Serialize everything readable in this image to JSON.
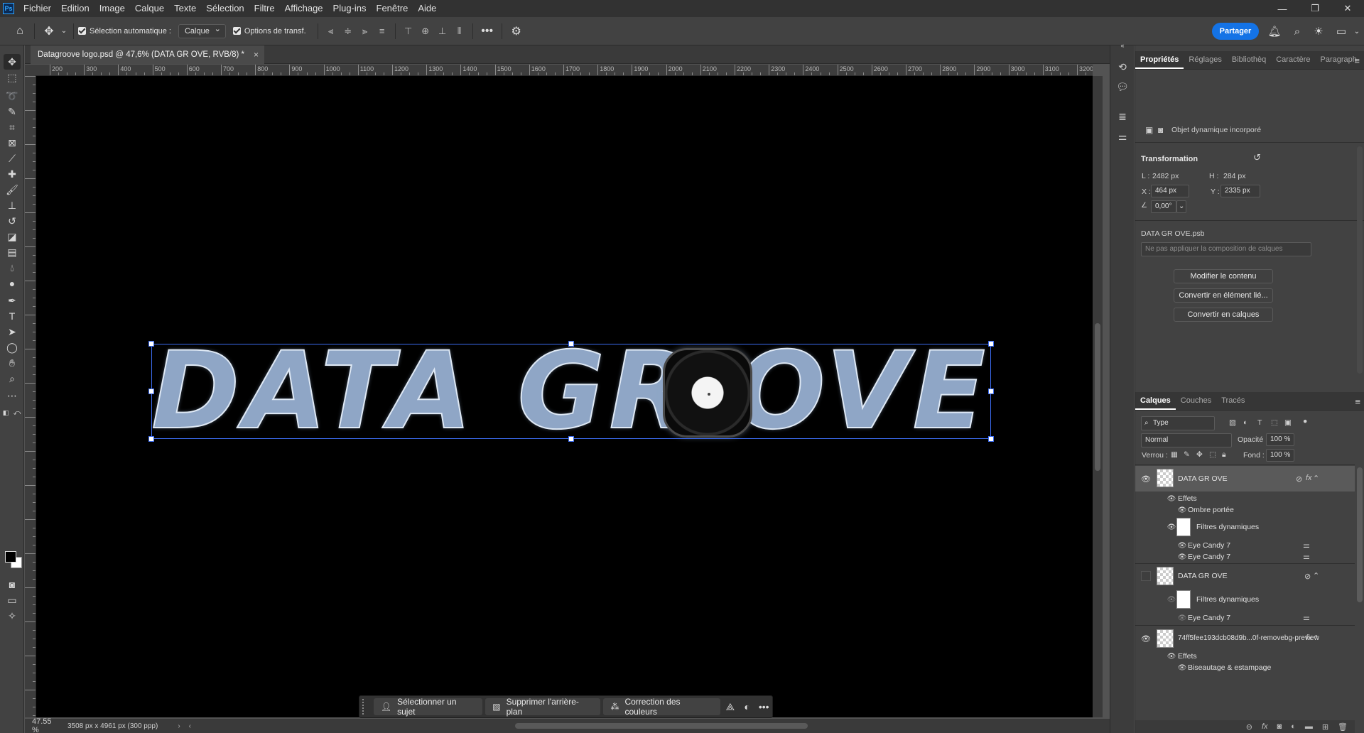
{
  "menubar": {
    "app_icon": "Ps",
    "items": [
      "Fichier",
      "Edition",
      "Image",
      "Calque",
      "Texte",
      "Sélection",
      "Filtre",
      "Affichage",
      "Plug-ins",
      "Fenêtre",
      "Aide"
    ],
    "window_controls": {
      "minimize": "—",
      "maximize": "❐",
      "close": "✕"
    }
  },
  "options": {
    "auto_select_label": "Sélection automatique :",
    "auto_select_checked": true,
    "auto_select_value": "Calque",
    "transform_label": "Options de transf.",
    "transform_checked": true,
    "more": "•••",
    "share_label": "Partager"
  },
  "document": {
    "tab_title": "Datagroove logo.psd @ 47,6% (DATA GR      OVE, RVB/8) *",
    "tab_close": "×",
    "zoom": "47.55 %",
    "info": "3508 px x 4961 px (300 ppp)",
    "logo_text_left": "DATA GR",
    "logo_text_right": "OVE",
    "canvas_color": "#000000",
    "selection_color": "#3c6cf0"
  },
  "ruler": {
    "top_labels": [
      "200",
      "300",
      "400",
      "500",
      "600",
      "700",
      "800",
      "900",
      "1000",
      "1100",
      "1200",
      "1300",
      "1400",
      "1500",
      "1600",
      "1700",
      "1800",
      "1900",
      "2000",
      "2100",
      "2200",
      "2300",
      "2400",
      "2500",
      "2600",
      "2700",
      "2800",
      "2900",
      "3000",
      "3100",
      "3200"
    ]
  },
  "taskbar": {
    "select_subject": "Sélectionner un sujet",
    "remove_bg": "Supprimer l'arrière-plan",
    "color_correction": "Correction des couleurs",
    "more": "•••"
  },
  "properties": {
    "tabs": [
      "Propriétés",
      "Réglages",
      "Bibliothèq",
      "Caractère",
      "Paragraph"
    ],
    "object_type": "Objet dynamique incorporé",
    "transform_title": "Transformation",
    "L_label": "L :",
    "L_value": "2482 px",
    "H_label": "H :",
    "H_value": "284 px",
    "X_label": "X :",
    "X_value": "464 px",
    "Y_label": "Y :",
    "Y_value": "2335 px",
    "angle_value": "0,00°",
    "source_name": "DATA GR      OVE.psb",
    "layer_comp_placeholder": "Ne pas appliquer la composition de calques",
    "btn_edit": "Modifier le contenu",
    "btn_convert_linked": "Convertir en élément lié...",
    "btn_convert_layers": "Convertir en calques"
  },
  "layers": {
    "tabs": [
      "Calques",
      "Couches",
      "Tracés"
    ],
    "filter_type": "Type",
    "blend_mode": "Normal",
    "opacity_label": "Opacité :",
    "opacity_value": "100 %",
    "lock_label": "Verrou :",
    "fill_label": "Fond :",
    "fill_value": "100 %",
    "rows": [
      {
        "name": "DATA GR      OVE"
      },
      {
        "name": "Effets"
      },
      {
        "name": "Ombre portée"
      },
      {
        "name": "Filtres dynamiques"
      },
      {
        "name": "Eye Candy 7"
      },
      {
        "name": "Eye Candy 7"
      },
      {
        "name": "DATA GR  OVE"
      },
      {
        "name": "Filtres dynamiques"
      },
      {
        "name": "Eye Candy 7"
      },
      {
        "name": "74ff5fee193dcb08d9b...0f-removebg-preview"
      },
      {
        "name": "Effets"
      },
      {
        "name": "Biseautage & estampage"
      }
    ]
  },
  "colors": {
    "accent": "#1473e6",
    "panel": "#424242",
    "dark": "#323232"
  }
}
